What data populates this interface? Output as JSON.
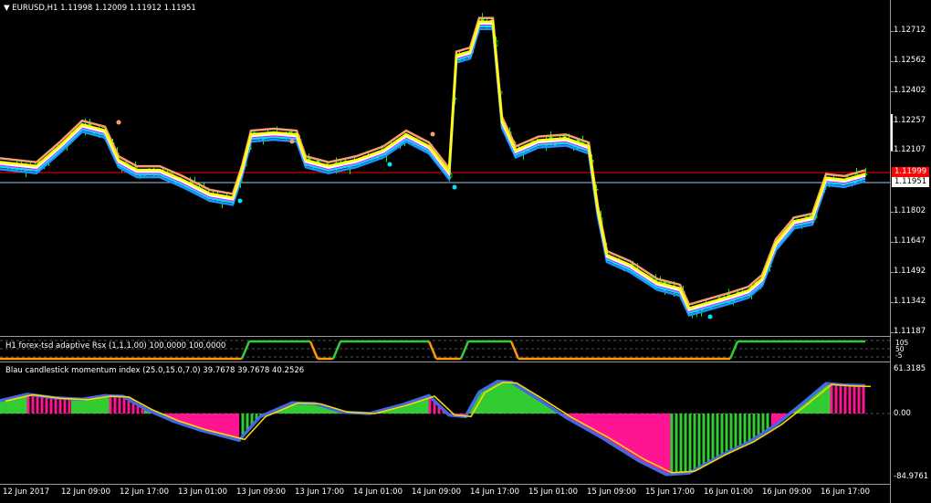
{
  "header": {
    "symbol_caption": "EURUSD,H1  1.11998 1.12009 1.11912 1.11951"
  },
  "price_axis": {
    "ticks": [
      "1.12712",
      "1.12562",
      "1.12402",
      "1.12257",
      "1.12107",
      "1.11802",
      "1.11647",
      "1.11492",
      "1.11342",
      "1.11187"
    ],
    "bid_tag": "1.11999",
    "last_tag": "1.11951"
  },
  "rsx_panel": {
    "caption": "H1 forex-tsd adaptive Rsx (1,1,1.00) 100.0000 100.0000",
    "axis_labels": [
      "105",
      "50",
      "-5"
    ]
  },
  "momentum_panel": {
    "caption": "Blau candlestick momentum index (25.0,15.0,7.0) 39.7678 39.7678 40.2526",
    "axis_labels": [
      "61.3185",
      "0.00",
      "-84.9761"
    ]
  },
  "time_axis": {
    "labels": [
      "12 Jun 2017",
      "12 Jun 09:00",
      "12 Jun 17:00",
      "13 Jun 01:00",
      "13 Jun 09:00",
      "13 Jun 17:00",
      "14 Jun 01:00",
      "14 Jun 09:00",
      "14 Jun 17:00",
      "15 Jun 01:00",
      "15 Jun 09:00",
      "15 Jun 17:00",
      "16 Jun 01:00",
      "16 Jun 09:00",
      "16 Jun 17:00"
    ]
  },
  "colors": {
    "background": "#000000",
    "bull_candle": "#00ff00",
    "bear_candle": "#00ff00",
    "doji": "#ffffff",
    "bid_line": "#ff0000",
    "last_line": "#a6cbe8",
    "cyan_line": "#00e5ff",
    "blue_line": "#1e90ff",
    "white_line": "#ffffff",
    "yellow_line": "#ffff00",
    "magenta_line": "#ff00ff",
    "salmon_line": "#f4a070",
    "rsx_green": "#32cd32",
    "rsx_orange": "#ff9900",
    "hist_green": "#32cd32",
    "hist_pink": "#ff1493",
    "mom_blue": "#4169e1",
    "mom_yellow": "#ffd700"
  },
  "chart_data": [
    {
      "type": "line",
      "title": "EURUSD,H1",
      "ylim": [
        1.1115,
        1.128
      ],
      "x": [
        "12 Jun 2017",
        "12 Jun 09:00",
        "12 Jun 17:00",
        "13 Jun 01:00",
        "13 Jun 09:00",
        "13 Jun 17:00",
        "14 Jun 01:00",
        "14 Jun 09:00",
        "14 Jun 17:00",
        "15 Jun 01:00",
        "15 Jun 09:00",
        "15 Jun 17:00",
        "16 Jun 01:00",
        "16 Jun 09:00",
        "16 Jun 17:00"
      ],
      "series": [
        {
          "values": [
            1.1205,
            1.1225,
            1.1198,
            1.1188,
            1.1222,
            1.1208,
            1.1212,
            1.122,
            1.1275,
            1.121,
            1.1168,
            1.1134,
            1.1144,
            1.118,
            1.1198
          ]
        },
        {
          "values": [
            1.1203,
            1.122,
            1.1199,
            1.1191,
            1.122,
            1.121,
            1.1209,
            1.1217,
            1.1278,
            1.1215,
            1.1164,
            1.1133,
            1.114,
            1.1176,
            1.1196
          ]
        },
        {
          "values": [
            1.12,
            1.1215,
            1.12,
            1.1194,
            1.1215,
            1.121,
            1.121,
            1.1215,
            1.1268,
            1.1216,
            1.116,
            1.113,
            1.1138,
            1.117,
            1.119
          ]
        }
      ]
    },
    {
      "type": "line",
      "title": "H1 forex-tsd adaptive Rsx (1,1,1.00)",
      "ylim": [
        -5,
        105
      ],
      "x": [
        "12 Jun 2017",
        "12 Jun 09:00",
        "12 Jun 17:00",
        "13 Jun 01:00",
        "13 Jun 09:00",
        "13 Jun 17:00",
        "14 Jun 01:00",
        "14 Jun 09:00",
        "14 Jun 17:00",
        "15 Jun 01:00",
        "15 Jun 09:00",
        "15 Jun 17:00",
        "16 Jun 01:00",
        "16 Jun 09:00",
        "16 Jun 17:00"
      ],
      "series": [
        {
          "values": [
            -5,
            -5,
            -5,
            -5,
            100,
            100,
            100,
            -5,
            100,
            -5,
            -5,
            -5,
            -5,
            100,
            100
          ]
        }
      ]
    },
    {
      "type": "bar",
      "title": "Blau candlestick momentum index (25.0,15.0,7.0)",
      "ylim": [
        -84.9761,
        61.3185
      ],
      "categories": [
        "12 Jun 2017",
        "12 Jun 09:00",
        "12 Jun 17:00",
        "13 Jun 01:00",
        "13 Jun 09:00",
        "13 Jun 17:00",
        "14 Jun 01:00",
        "14 Jun 09:00",
        "14 Jun 17:00",
        "15 Jun 01:00",
        "15 Jun 09:00",
        "15 Jun 17:00",
        "16 Jun 01:00",
        "16 Jun 09:00",
        "16 Jun 17:00"
      ],
      "series": [
        {
          "values": [
            20,
            28,
            -10,
            -35,
            12,
            8,
            -2,
            20,
            40,
            -30,
            -80,
            -60,
            -20,
            30,
            40
          ]
        },
        {
          "values": [
            18,
            26,
            -8,
            -33,
            10,
            9,
            -1,
            18,
            42,
            -25,
            -82,
            -65,
            -22,
            25,
            39
          ]
        }
      ]
    }
  ]
}
